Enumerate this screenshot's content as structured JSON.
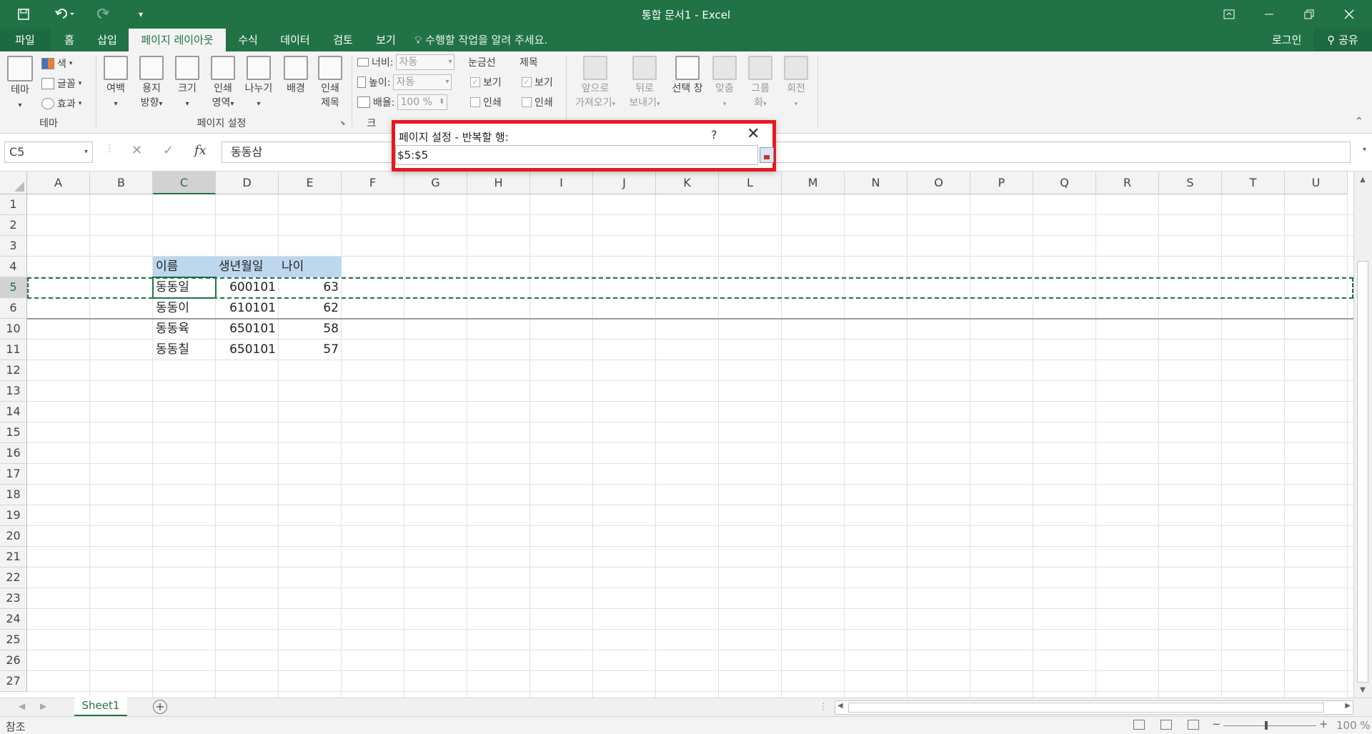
{
  "titlebar": {
    "title": "통합 문서1 - Excel",
    "quick_access": {
      "save_icon": "save-icon",
      "undo_icon": "undo-icon",
      "redo_icon": "redo-icon",
      "customize_icon": "customize-icon"
    }
  },
  "menu": {
    "tabs": [
      "파일",
      "홈",
      "삽입",
      "페이지 레이아웃",
      "수식",
      "데이터",
      "검토",
      "보기"
    ],
    "active_tab": "페이지 레이아웃",
    "tell_me": "수행할 작업을 알려 주세요.",
    "login": "로그인",
    "share": "공유"
  },
  "ribbon": {
    "theme_group": {
      "label": "테마",
      "theme_button": "테마",
      "colors": "색",
      "fonts": "글꼴",
      "effects": "효과"
    },
    "page_setup_group": {
      "label": "페이지 설정",
      "margins": [
        "여백"
      ],
      "orientation": [
        "용지",
        "방향"
      ],
      "size": [
        "크기"
      ],
      "print_area": [
        "인쇄",
        "영역"
      ],
      "breaks": [
        "나누기"
      ],
      "background": [
        "배경"
      ],
      "print_titles": [
        "인쇄",
        "제목"
      ]
    },
    "scale_group": {
      "label": "크",
      "width_label": "너비:",
      "width_value": "자동",
      "height_label": "높이:",
      "height_value": "자동",
      "scale_label": "배율:",
      "scale_value": "100 %"
    },
    "sheet_options": {
      "gridlines": "눈금선",
      "headings": "제목",
      "view": "보기",
      "print": "인쇄"
    },
    "arrange_group": {
      "bring_forward": [
        "앞으로",
        "가져오기"
      ],
      "send_backward": [
        "뒤로",
        "보내기"
      ],
      "selection_pane": [
        "선택 창"
      ],
      "align": [
        "맞춤"
      ],
      "group": [
        "그룹",
        "화"
      ],
      "rotate": [
        "회전"
      ]
    }
  },
  "formula_bar": {
    "name_box": "C5",
    "cancel_icon": "✕",
    "enter_icon": "✓",
    "fx": "fx",
    "value": "동동삼"
  },
  "grid": {
    "columns": [
      "A",
      "B",
      "C",
      "D",
      "E",
      "F",
      "G",
      "H",
      "I",
      "J",
      "K",
      "L",
      "M",
      "N",
      "O",
      "P",
      "Q",
      "R",
      "S",
      "T",
      "U"
    ],
    "rows": [
      "1",
      "2",
      "3",
      "4",
      "5",
      "6",
      "10",
      "11",
      "12",
      "13",
      "14",
      "15",
      "16",
      "17",
      "18",
      "19",
      "20",
      "21",
      "22",
      "23",
      "24",
      "25",
      "26",
      "27"
    ],
    "header_row": {
      "name": "이름",
      "birth": "생년월일",
      "age": "나이"
    },
    "data_rows": [
      {
        "name": "동동일",
        "birth": "600101",
        "age": "63"
      },
      {
        "name": "동동이",
        "birth": "610101",
        "age": "62"
      },
      {
        "name": "동동육",
        "birth": "650101",
        "age": "58"
      },
      {
        "name": "동동칠",
        "birth": "650101",
        "age": "57"
      }
    ]
  },
  "sheets": {
    "active": "Sheet1"
  },
  "status": {
    "mode": "참조",
    "zoom": "100 %"
  },
  "dialog": {
    "title": "페이지 설정 - 반복할 행:",
    "help": "?",
    "close": "✕",
    "value": "$5:$5"
  },
  "colors": {
    "excel_green": "#217346",
    "highlight": "#bdd7ee",
    "dialog_border": "#e21b23"
  }
}
